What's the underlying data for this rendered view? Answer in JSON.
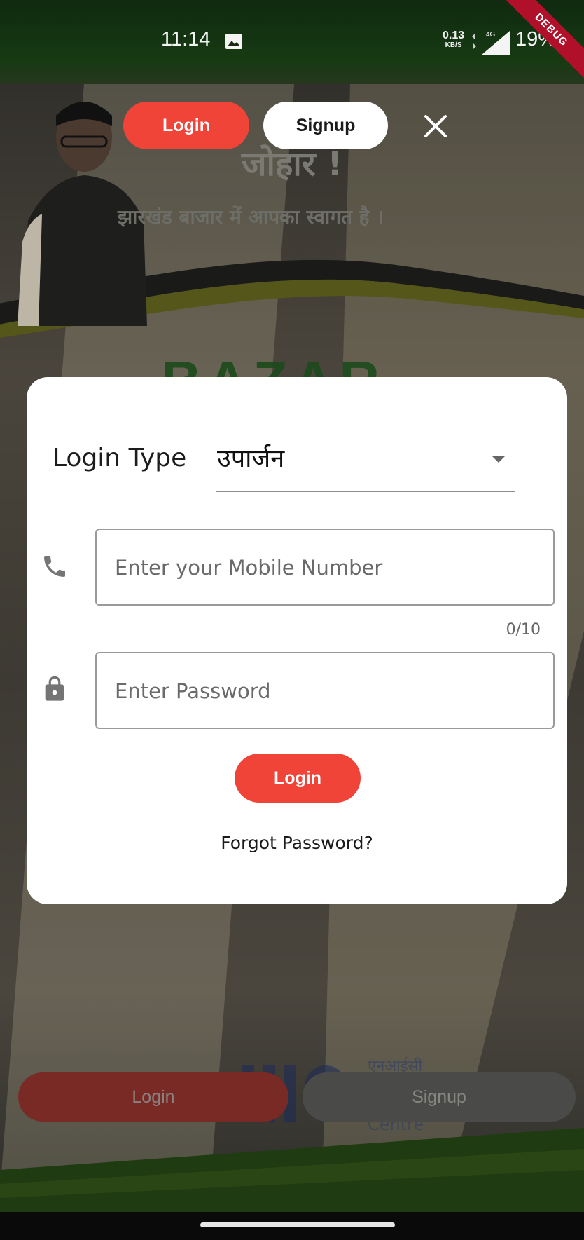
{
  "status_bar": {
    "time": "11:14",
    "net_speed": "0.13",
    "net_speed_unit": "KB/S",
    "network": "4G",
    "battery": "19%",
    "debug_label": "DEBUG"
  },
  "top_tabs": {
    "login_label": "Login",
    "signup_label": "Signup"
  },
  "background": {
    "greeting_title": "जोहार !",
    "greeting_subtitle": "झारखंड बाजार में आपका स्वागत है ।",
    "brand_text": "BAZAR",
    "nic_hindi": "एनआईसी",
    "nic_english": "Centre"
  },
  "dialog": {
    "login_type_label": "Login Type",
    "login_type_value": "उपार्जन",
    "mobile_placeholder": "Enter your Mobile Number",
    "mobile_counter": "0/10",
    "password_placeholder": "Enter Password",
    "login_button": "Login",
    "forgot_password": "Forgot Password?"
  },
  "bottom_buttons": {
    "login_label": "Login",
    "signup_label": "Signup"
  },
  "colors": {
    "accent": "#f04438",
    "dialog_bg": "#ffffff"
  }
}
